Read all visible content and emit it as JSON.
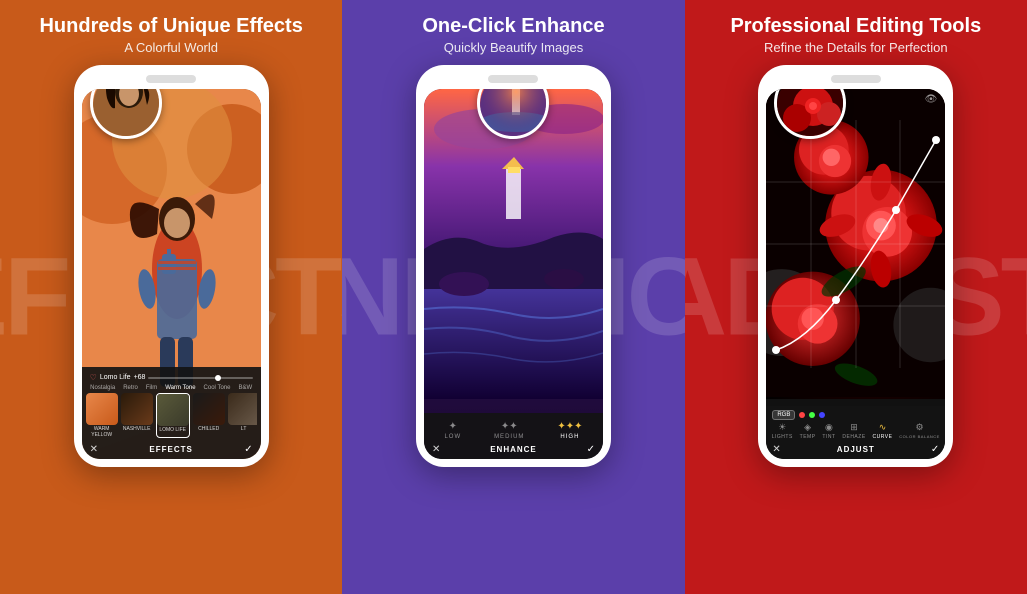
{
  "panels": [
    {
      "id": "panel-1",
      "bg_color": "#C85A1A",
      "bg_text": "EFFECTS",
      "title": "Hundreds of Unique Effects",
      "subtitle": "A Colorful World",
      "screen_type": "effects",
      "filter_row_labels": [
        "NOSTALGIA",
        "RETRO",
        "FILM",
        "WARM TONE",
        "COOL TONE",
        "B&W"
      ],
      "active_filter": "Warm Tone",
      "lomo_label": "Lomo Life",
      "lomo_value": "+68",
      "thumbnails": [
        {
          "label": "WARM YELLOW"
        },
        {
          "label": "NASHVILLE"
        },
        {
          "label": "LOMO LIFE"
        },
        {
          "label": "CHILLED"
        },
        {
          "label": "LT"
        }
      ],
      "bottom_label": "EFFECTS",
      "close_icon": "✕",
      "check_icon": "✓"
    },
    {
      "id": "panel-2",
      "bg_color": "#5B3FAA",
      "bg_text": "ENHANCE",
      "title": "One-Click Enhance",
      "subtitle": "Quickly Beautify Images",
      "screen_type": "enhance",
      "enhance_options": [
        {
          "label": "LOW",
          "icon": "✦",
          "active": false
        },
        {
          "label": "MEDIUM",
          "icon": "✦✦",
          "active": false
        },
        {
          "label": "HIGH",
          "icon": "✦✦✦",
          "active": true
        }
      ],
      "bottom_label": "ENHANCE",
      "close_icon": "✕",
      "check_icon": "✓"
    },
    {
      "id": "panel-3",
      "bg_color": "#C0191A",
      "bg_text": "ADJUST",
      "title": "Professional Editing Tools",
      "subtitle": "Refine the Details for Perfection",
      "screen_type": "adjust",
      "rgb_label": "RGB",
      "adjust_tools": [
        {
          "label": "LIGHTS",
          "icon": "☀"
        },
        {
          "label": "TEMP",
          "icon": "◈"
        },
        {
          "label": "TINT",
          "icon": "◉"
        },
        {
          "label": "DEHAZE",
          "icon": "⊞"
        },
        {
          "label": "CURVE",
          "icon": "∿",
          "active": true
        },
        {
          "label": "COLOR BALANCE",
          "icon": "⚙"
        }
      ],
      "bottom_label": "ADJUST",
      "close_icon": "✕",
      "check_icon": "✓"
    }
  ]
}
